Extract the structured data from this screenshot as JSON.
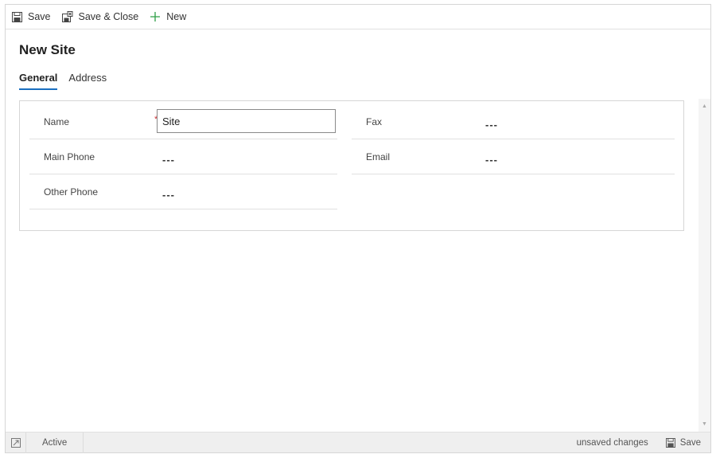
{
  "toolbar": {
    "save_label": "Save",
    "save_close_label": "Save & Close",
    "new_label": "New"
  },
  "page": {
    "title": "New Site"
  },
  "tabs": [
    {
      "label": "General",
      "active": true
    },
    {
      "label": "Address",
      "active": false
    }
  ],
  "form": {
    "name": {
      "label": "Name",
      "required_mark": "*",
      "value": "Site"
    },
    "main_phone": {
      "label": "Main Phone",
      "value": "---"
    },
    "other_phone": {
      "label": "Other Phone",
      "value": "---"
    },
    "fax": {
      "label": "Fax",
      "value": "---"
    },
    "email": {
      "label": "Email",
      "value": "---"
    }
  },
  "statusbar": {
    "status": "Active",
    "unsaved": "unsaved changes",
    "save_label": "Save"
  },
  "colors": {
    "accent": "#1a6fc0",
    "new_icon": "#2d9f46",
    "required": "#d13438"
  }
}
